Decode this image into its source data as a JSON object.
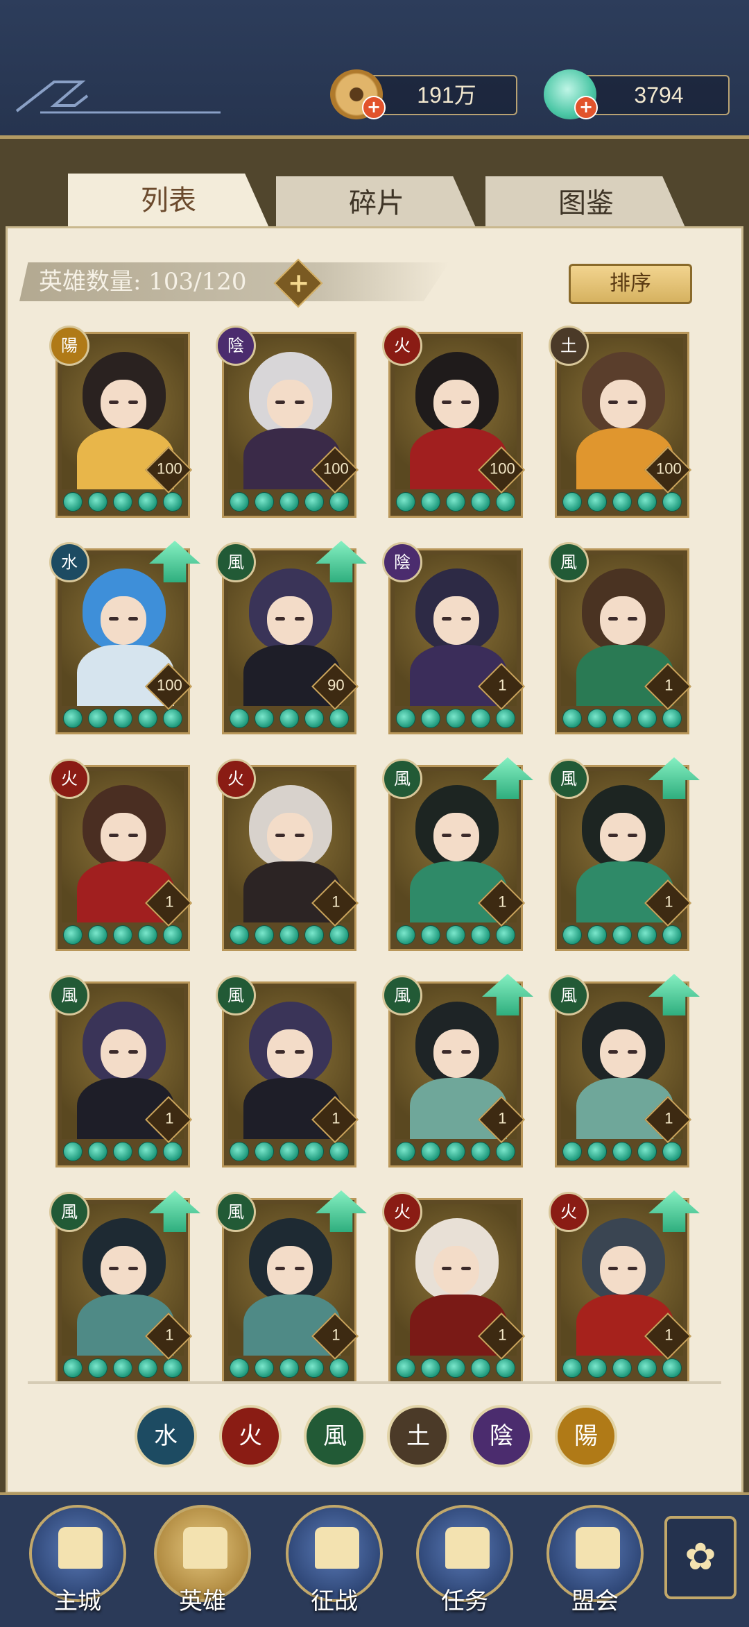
{
  "currencies": {
    "coins": "191万",
    "jade": "3794",
    "plus": "+"
  },
  "tabs": [
    {
      "label": "列表",
      "active": true
    },
    {
      "label": "碎片",
      "active": false
    },
    {
      "label": "图鉴",
      "active": false
    }
  ],
  "hero_count_label": "英雄数量: 103/120",
  "add_slot_label": "+",
  "sort_button": "排序",
  "element_glyphs": {
    "water": "水",
    "fire": "火",
    "wind": "風",
    "earth": "土",
    "yin": "陰",
    "yang": "陽"
  },
  "heroes": [
    {
      "element": "yang",
      "level": "100",
      "upgrade": false
    },
    {
      "element": "yin",
      "level": "100",
      "upgrade": false
    },
    {
      "element": "fire",
      "level": "100",
      "upgrade": false
    },
    {
      "element": "earth",
      "level": "100",
      "upgrade": false
    },
    {
      "element": "water",
      "level": "100",
      "upgrade": true
    },
    {
      "element": "wind",
      "level": "90",
      "upgrade": true
    },
    {
      "element": "yin",
      "level": "1",
      "upgrade": false
    },
    {
      "element": "wind",
      "level": "1",
      "upgrade": false
    },
    {
      "element": "fire",
      "level": "1",
      "upgrade": false
    },
    {
      "element": "fire",
      "level": "1",
      "upgrade": false
    },
    {
      "element": "wind",
      "level": "1",
      "upgrade": true
    },
    {
      "element": "wind",
      "level": "1",
      "upgrade": true
    },
    {
      "element": "wind",
      "level": "1",
      "upgrade": false
    },
    {
      "element": "wind",
      "level": "1",
      "upgrade": false
    },
    {
      "element": "wind",
      "level": "1",
      "upgrade": true
    },
    {
      "element": "wind",
      "level": "1",
      "upgrade": true
    },
    {
      "element": "wind",
      "level": "1",
      "upgrade": true
    },
    {
      "element": "wind",
      "level": "1",
      "upgrade": true
    },
    {
      "element": "fire",
      "level": "1",
      "upgrade": false
    },
    {
      "element": "fire",
      "level": "1",
      "upgrade": true
    }
  ],
  "element_filters": [
    "water",
    "fire",
    "wind",
    "earth",
    "yin",
    "yang"
  ],
  "nav": [
    {
      "label": "主城",
      "active": false
    },
    {
      "label": "英雄",
      "active": true
    },
    {
      "label": "征战",
      "active": false
    },
    {
      "label": "任务",
      "active": false
    },
    {
      "label": "盟会",
      "active": false
    }
  ],
  "colors": {
    "bead": "#2fb892",
    "upgrade_arrow": "#3fc08c",
    "panel": "#f2ead8",
    "topbar": "#2d3d5b"
  },
  "icons": {
    "coin": "ancient-coin-icon",
    "jade": "jade-shell-icon",
    "upgrade": "upgrade-arrow-icon",
    "menu": "clover-menu-icon"
  }
}
